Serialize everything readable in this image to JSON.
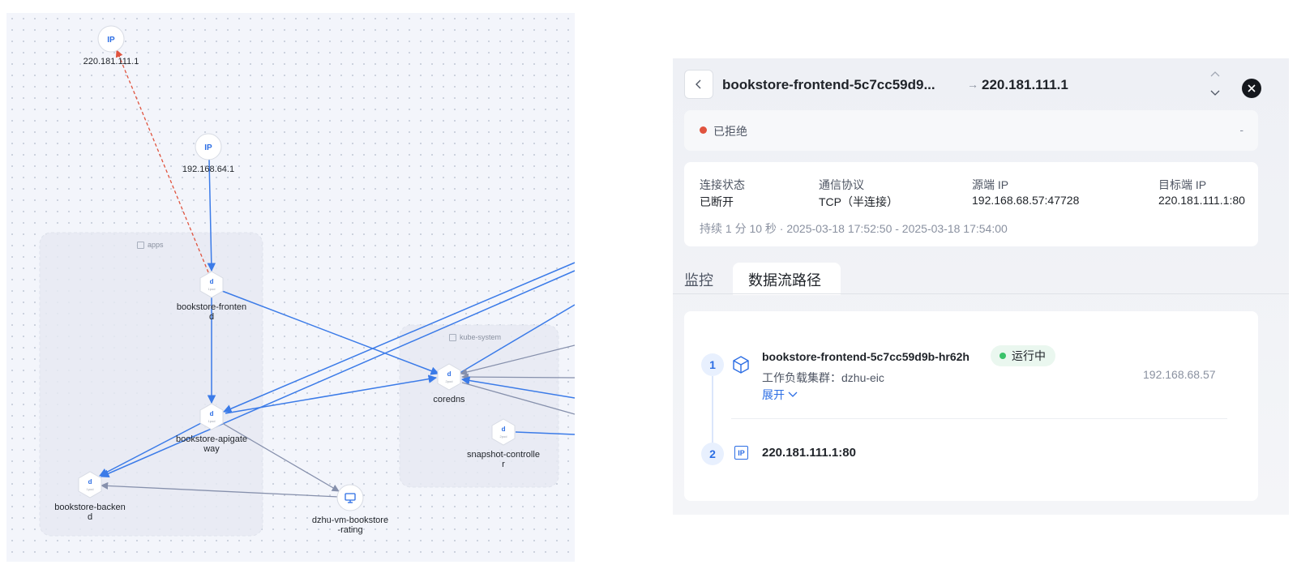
{
  "topology": {
    "groups": {
      "apps": "apps",
      "kube_system": "kube-system"
    },
    "nodes": {
      "ip_public": {
        "icon_text": "IP",
        "label": "220.181.111.1"
      },
      "ip_node": {
        "icon_text": "IP",
        "label": "192.168.64.1"
      },
      "frontend": {
        "icon_text": "d",
        "sub": "1pod",
        "label": "bookstore-fronten\nd"
      },
      "apigateway": {
        "icon_text": "d",
        "sub": "1pod",
        "label": "bookstore-apigate\nway"
      },
      "backend": {
        "icon_text": "d",
        "sub": "1pod",
        "label": "bookstore-backen\nd"
      },
      "coredns": {
        "icon_text": "d",
        "sub": "2pod",
        "label": "coredns"
      },
      "snapshot": {
        "icon_text": "d",
        "sub": "2pod",
        "label": "snapshot-controlle\nr"
      },
      "vm_rating": {
        "label": "dzhu-vm-bookstore\n-rating"
      }
    },
    "colors": {
      "edge_allowed": "#3b7be8",
      "edge_denied": "#e0533e",
      "edge_muted": "#8690ac",
      "node_accent": "#2b6de4"
    }
  },
  "panel": {
    "source_name": "bookstore-frontend-5c7cc59d9...",
    "arrow": "→",
    "dest_name": "220.181.111.1",
    "verdict": {
      "text": "已拒绝",
      "color": "#e0533e",
      "extra": "-"
    },
    "info": {
      "state_label": "连接状态",
      "state_value": "已断开",
      "protocol_label": "通信协议",
      "protocol_value": "TCP（半连接）",
      "src_ip_label": "源端 IP",
      "src_ip_value": "192.168.68.57:47728",
      "dst_ip_label": "目标端 IP",
      "dst_ip_value": "220.181.111.1:80",
      "duration_text": "持续 1 分 10 秒 · 2025-03-18 17:52:50 - 2025-03-18 17:54:00"
    },
    "tabs": [
      {
        "label": "监控",
        "active": false
      },
      {
        "label": "数据流路径",
        "active": true
      }
    ],
    "path": {
      "step1": {
        "index": "1",
        "name": "bookstore-frontend-5c7cc59d9b-hr62h",
        "status": "运行中",
        "status_color": "#3ac26a",
        "cluster": "工作负载集群：dzhu-eic",
        "expand_label": "展开",
        "ip": "192.168.68.57"
      },
      "step2": {
        "index": "2",
        "icon_text": "IP",
        "name": "220.181.111.1:80"
      }
    }
  }
}
